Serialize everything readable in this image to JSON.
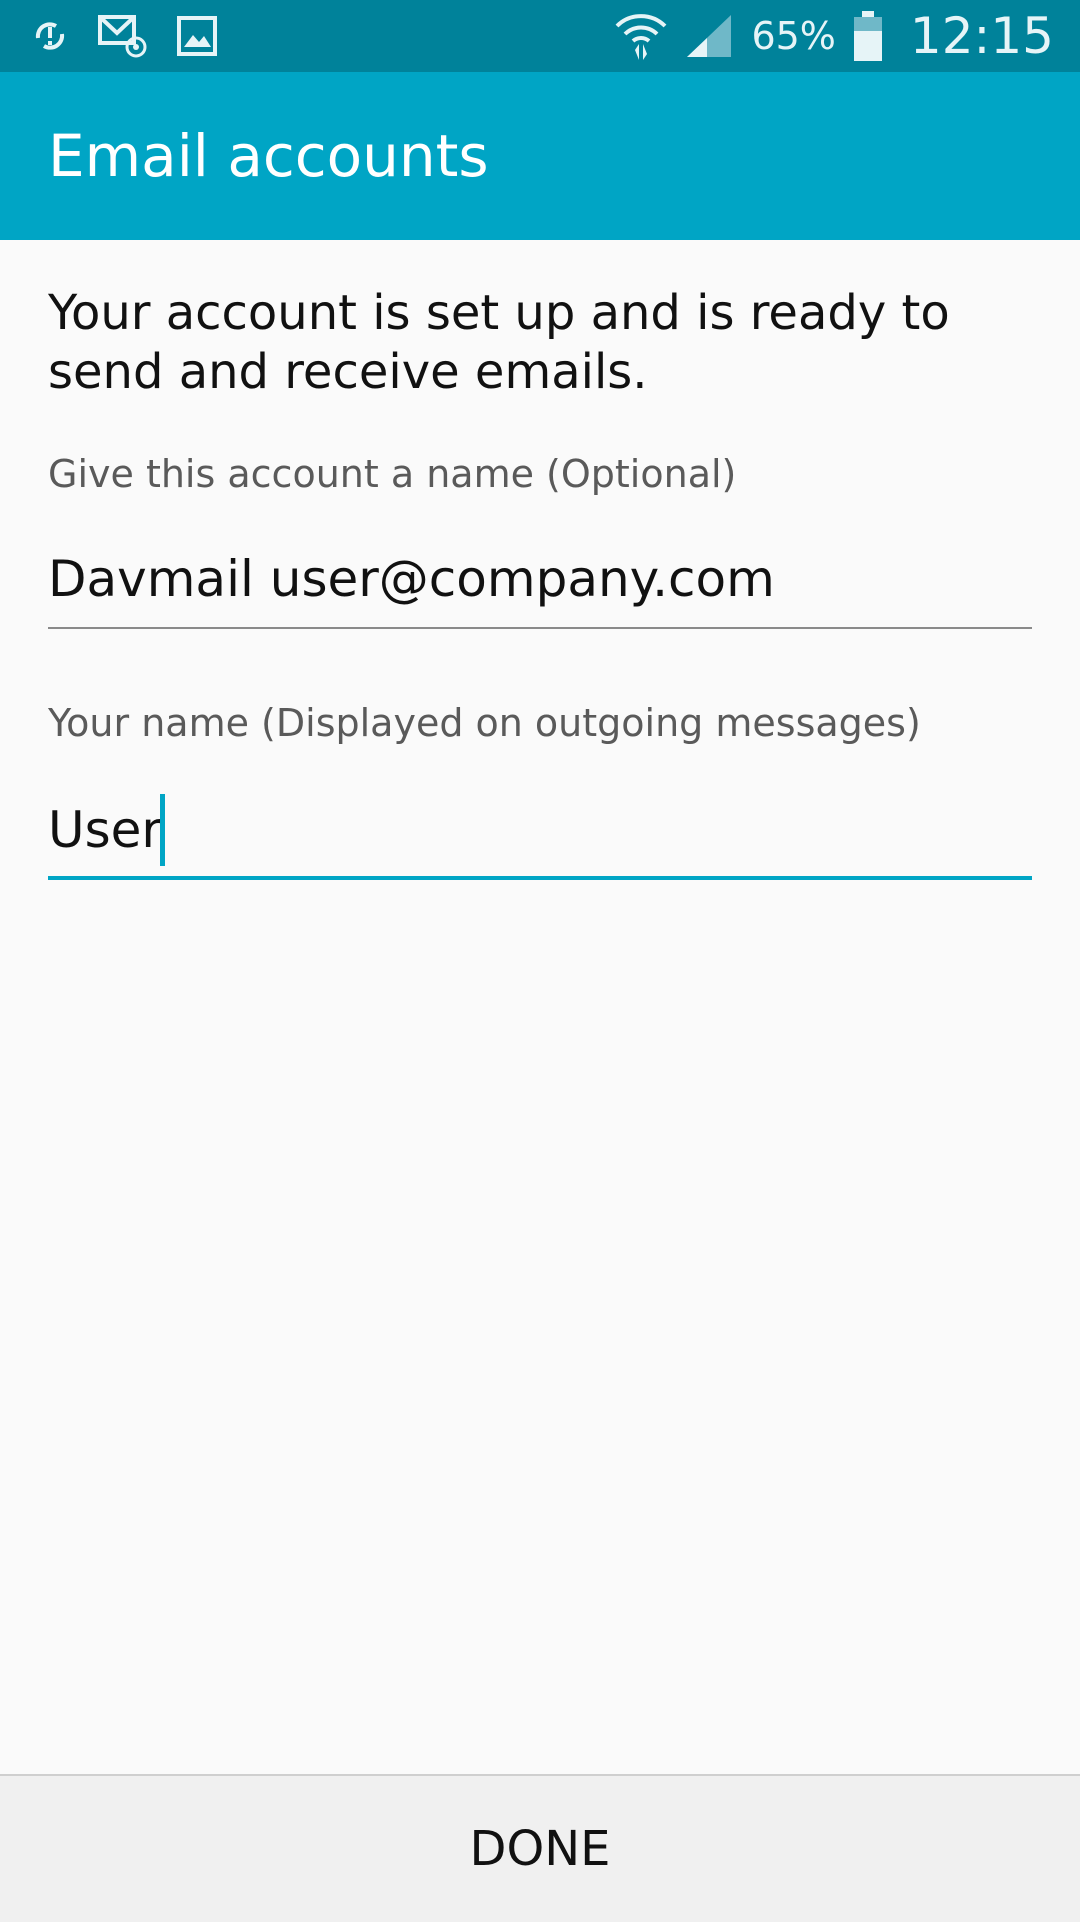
{
  "status_bar": {
    "icons_left": [
      "sync-error-icon",
      "email-notification-icon",
      "image-notification-icon"
    ],
    "icons_right": [
      "wifi-icon",
      "cell-signal-icon",
      "battery-icon"
    ],
    "battery_percent": "65%",
    "time": "12:15"
  },
  "app_bar": {
    "title": "Email accounts"
  },
  "main": {
    "message": "Your account is set up and is ready to send and receive emails.",
    "account_name_label": "Give this account a name (Optional)",
    "account_name_value": "Davmail user@company.com",
    "your_name_label": "Your name (Displayed on outgoing messages)",
    "your_name_value": "User"
  },
  "bottom_bar": {
    "done_label": "DONE"
  },
  "colors": {
    "status_bar": "#00829a",
    "app_bar": "#00a5c5",
    "accent": "#00a5c5",
    "background": "#fafafa",
    "bottom_bar": "#f0f0f0"
  }
}
